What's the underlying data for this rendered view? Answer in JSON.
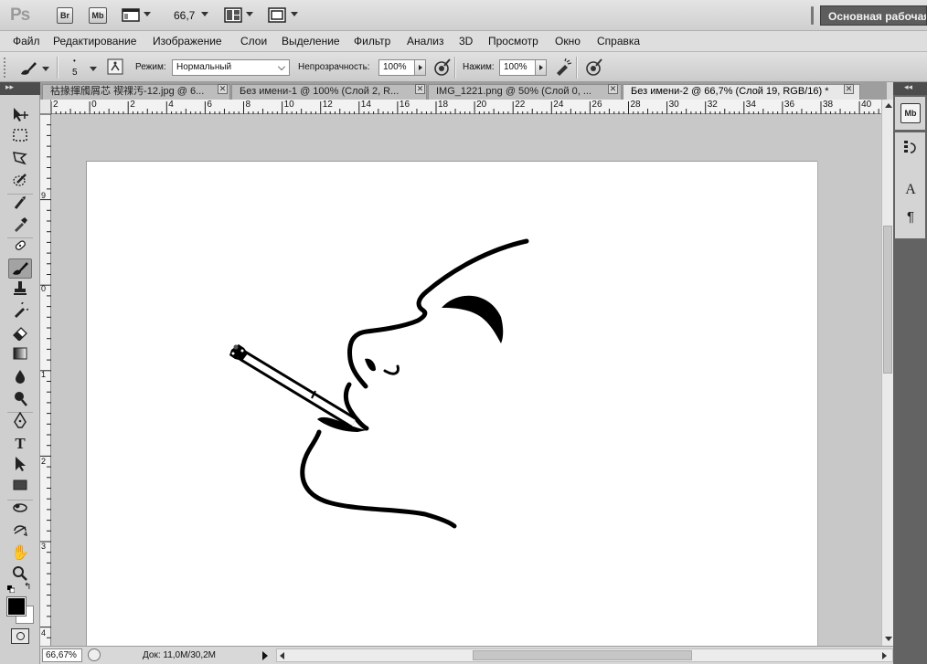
{
  "app": {
    "logo": "Ps"
  },
  "titlebar": {
    "bridge_button": "Br",
    "minibridge_button": "Mb",
    "zoom_level": "66,7",
    "workspace_button": "Основная рабочая"
  },
  "menu": {
    "items": [
      "Файл",
      "Редактирование",
      "Изображение",
      "Слои",
      "Выделение",
      "Фильтр",
      "Анализ",
      "3D",
      "Просмотр",
      "Окно",
      "Справка"
    ]
  },
  "options": {
    "brush_size": "5",
    "mode_label": "Режим:",
    "mode_value": "Нормальный",
    "opacity_label": "Непрозрачность:",
    "opacity_value": "100%",
    "pressure_label": "Нажим:",
    "pressure_value": "100%"
  },
  "tabs": [
    {
      "label": "祜掾揮斶屑芯 禊祼汚-12.jpg @ 6...",
      "active": false
    },
    {
      "label": "Без имени-1 @ 100% (Слой 2, R...",
      "active": false
    },
    {
      "label": "IMG_1221.png @ 50% (Слой 0, ...",
      "active": false
    },
    {
      "label": "Без имени-2 @ 66,7% (Слой 19, RGB/16) *",
      "active": true
    }
  ],
  "ruler_top": [
    "2",
    "0",
    "2",
    "4",
    "6",
    "8",
    "10",
    "12",
    "14",
    "16",
    "18",
    "20",
    "22",
    "24",
    "26",
    "28",
    "30",
    "32",
    "34",
    "36",
    "38",
    "40"
  ],
  "ruler_left": [
    "9",
    "0",
    "1",
    "2",
    "3",
    "4"
  ],
  "status": {
    "zoom": "66,67%",
    "doc_info": "Док: 11,0M/30,2M"
  },
  "dock": {
    "mb_icon": "Mb",
    "char_icon": "A",
    "para_icon": "¶"
  }
}
